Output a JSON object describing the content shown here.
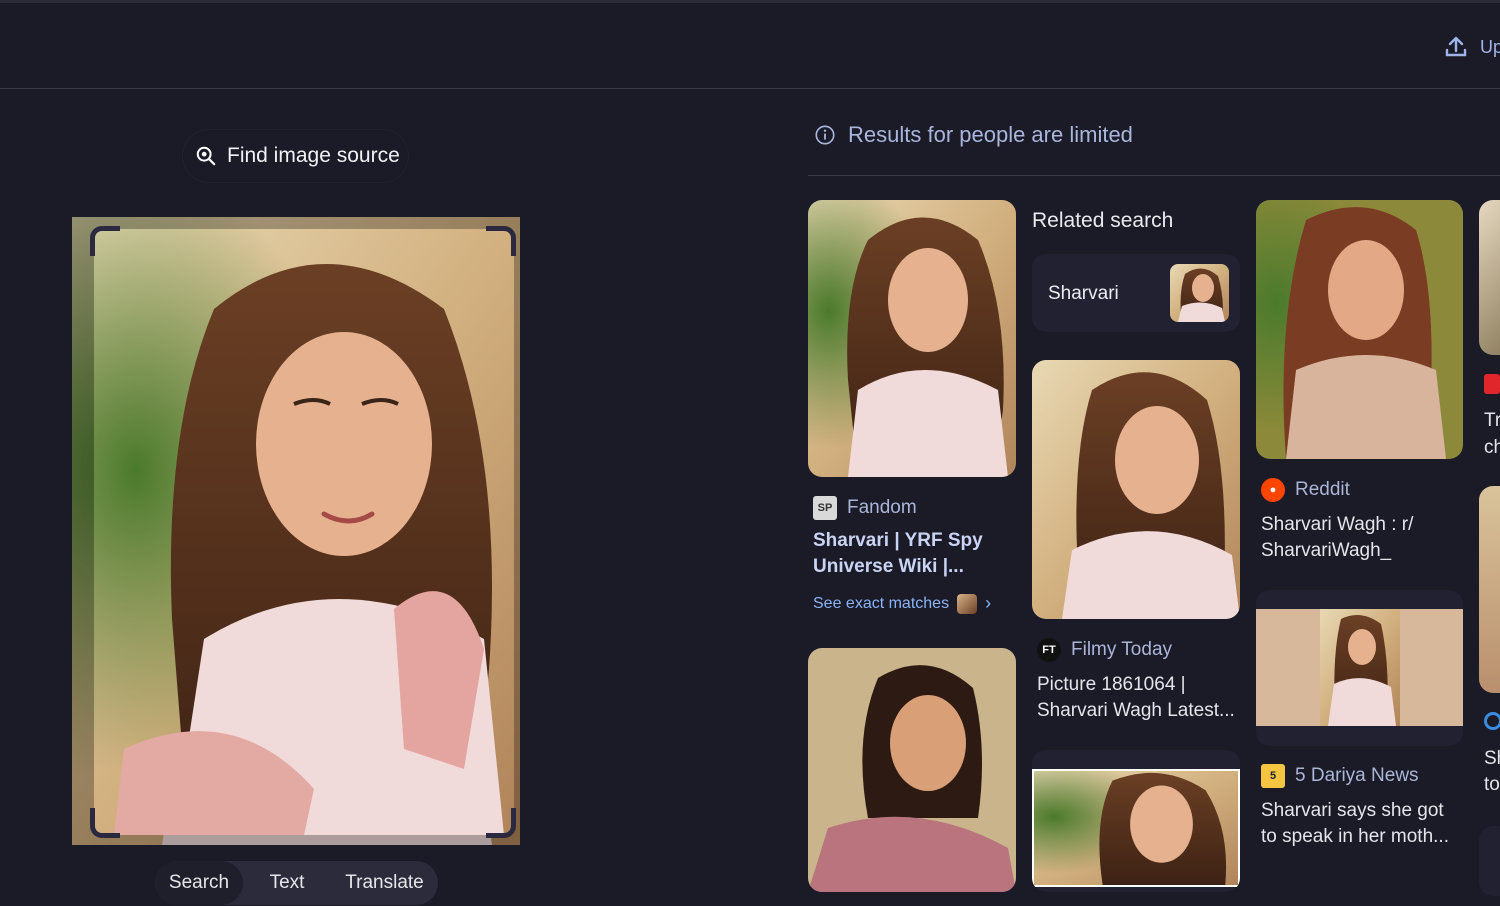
{
  "header": {
    "upload_label": "Up"
  },
  "left": {
    "find_source_label": "Find image source",
    "tabs": [
      "Search",
      "Text",
      "Translate"
    ]
  },
  "results": {
    "notice": "Results for people are limited",
    "related_heading": "Related search",
    "related_chip": "Sharvari",
    "cards": [
      {
        "source": "Fandom",
        "title": "Sharvari | YRF Spy Universe Wiki |...",
        "link": "See exact matches"
      },
      {
        "source": "Filmy Today",
        "title": "Picture 1861064 | Sharvari Wagh Latest..."
      },
      {
        "source": "Reddit",
        "title": "Sharvari Wagh : r/ SharvariWagh_"
      },
      {
        "source": "5 Dariya News",
        "title": "Sharvari says she got to speak in her moth..."
      }
    ],
    "edge": {
      "line1": "Tr",
      "line2": "ch",
      "line3": "Sh",
      "line4": "to"
    }
  },
  "colors": {
    "background": "#1b1a27",
    "link": "#8ab4f8",
    "muted_blue": "#aab5d8"
  }
}
